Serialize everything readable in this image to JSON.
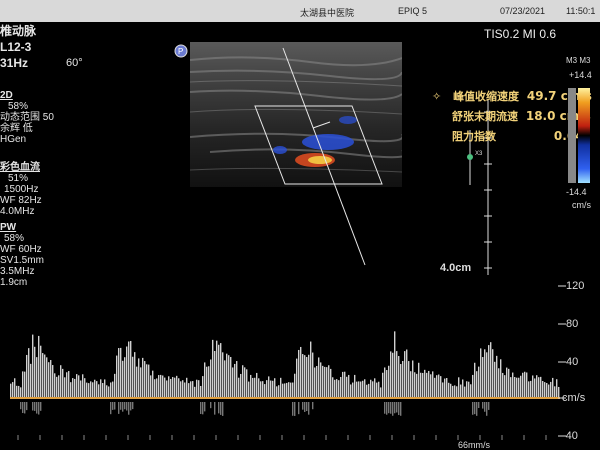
{
  "header": {
    "hospital": "太湖县中医院",
    "device": "EPIQ 5",
    "date": "07/23/2021",
    "time": "11:50:1"
  },
  "exam": {
    "title": "椎动脉",
    "probe": "L12-3",
    "rate": "31Hz",
    "angle": "60°"
  },
  "params_2d": {
    "head": "2D",
    "gain": "58%",
    "dynamic_range": "动态范围 50",
    "smoothing": "余辉 低",
    "mode": "HGen"
  },
  "params_color": {
    "head": "彩色血流",
    "gain": "51%",
    "prf": "1500Hz",
    "wf": "WF 82Hz",
    "freq": "4.0MHz"
  },
  "params_pw": {
    "head": "PW",
    "gain": "58%",
    "wf": "WF 60Hz",
    "sv": "SV1.5mm",
    "freq": "3.5MHz",
    "depth": "1.9cm"
  },
  "tis_mi": "TIS0.2  MI 0.6",
  "measurements": [
    {
      "label": "峰值收缩速度",
      "value": "49.7 cm/s"
    },
    {
      "label": "舒张末期流速",
      "value": "18.0 cm/s"
    },
    {
      "label": "阻力指数",
      "value": "0.64"
    }
  ],
  "colorbar": {
    "label": "M3 M3",
    "top": "+14.4",
    "bottom": "-14.4",
    "unit": "cm/s"
  },
  "depth_label": "4.0cm",
  "doppler_scale": {
    "ticks": [
      "120",
      "80",
      "40",
      "cm/s",
      "-40"
    ],
    "sweep": "66mm/s"
  },
  "colors": {
    "topbar": "#d9d9d9",
    "accent": "#f2d27a",
    "baseline": "#e0a040"
  }
}
